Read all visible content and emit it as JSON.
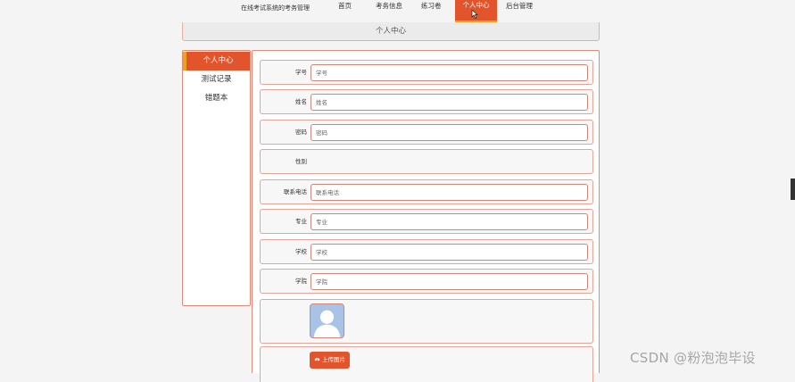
{
  "nav": {
    "site_title": "在线考试系统的考务管理",
    "items": [
      {
        "label": "首页"
      },
      {
        "label": "考务信息"
      },
      {
        "label": "练习卷"
      },
      {
        "label": "个人中心"
      },
      {
        "label": "后台管理"
      }
    ],
    "active_index": 3
  },
  "header": {
    "title": "个人中心"
  },
  "sidebar": {
    "items": [
      {
        "label": "个人中心"
      },
      {
        "label": "测试记录"
      },
      {
        "label": "错题本"
      }
    ]
  },
  "form": {
    "fields": [
      {
        "label": "学号",
        "placeholder": "学号"
      },
      {
        "label": "姓名",
        "placeholder": "姓名"
      },
      {
        "label": "密码",
        "placeholder": "密码"
      },
      {
        "label": "性别"
      },
      {
        "label": "联系电话",
        "placeholder": "联系电话"
      },
      {
        "label": "专业",
        "placeholder": "专业"
      },
      {
        "label": "学校",
        "placeholder": "学校"
      },
      {
        "label": "学院",
        "placeholder": "学院"
      }
    ],
    "upload_label": "上传图片"
  },
  "watermark": "CSDN @粉泡泡毕设",
  "colors": {
    "accent": "#e2542b",
    "accent_border": "#e9a31c",
    "panel_border": "#e08a78"
  }
}
